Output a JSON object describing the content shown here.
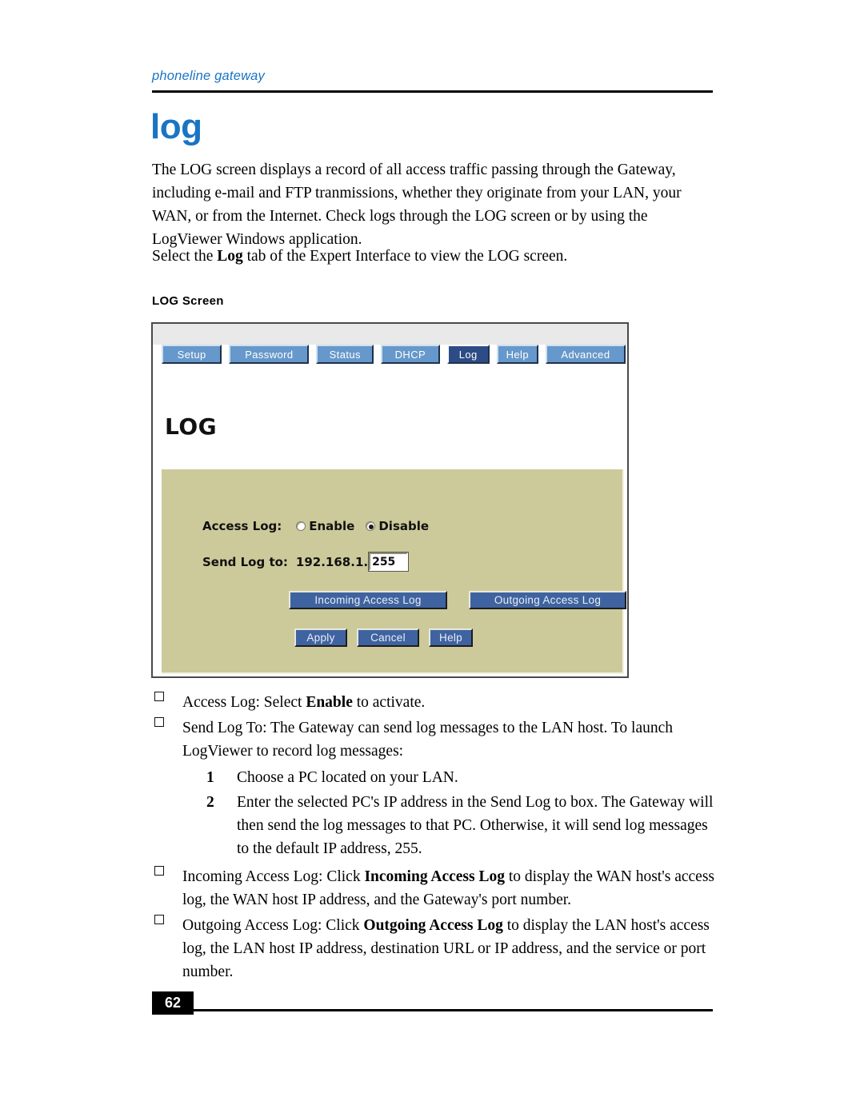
{
  "header": {
    "running_head": "phoneline gateway"
  },
  "chapter": {
    "title": "log"
  },
  "body": {
    "paragraph_1_part1": "The LOG screen displays a record of all access traffic passing through the Gateway, including e-mail and FTP tranmissions, whether they originate from your LAN, your WAN, or from the Internet. Check logs through the LOG screen or by using the LogViewer Windows application.",
    "paragraph_2_pre": "Select the ",
    "paragraph_2_bold": "Log",
    "paragraph_2_post": " tab of the Expert Interface to view the LOG screen."
  },
  "figure": {
    "caption": "LOG Screen",
    "tabs": [
      {
        "label": "Setup",
        "active": false
      },
      {
        "label": "Password",
        "active": false
      },
      {
        "label": "Status",
        "active": false
      },
      {
        "label": "DHCP",
        "active": false
      },
      {
        "label": "Log",
        "active": true
      },
      {
        "label": "Help",
        "active": false
      },
      {
        "label": "Advanced",
        "active": false
      }
    ],
    "screen_heading": "LOG",
    "fields": {
      "access_log_label": "Access Log:",
      "access_log_option_enable": "Enable",
      "access_log_option_disable": "Disable",
      "access_log_selected": "Disable",
      "send_log_label": "Send Log to:",
      "send_log_prefix": "192.168.1.",
      "send_log_value": "255"
    },
    "buttons": {
      "incoming_access_log": "Incoming Access Log",
      "outgoing_access_log": "Outgoing Access Log",
      "apply": "Apply",
      "cancel": "Cancel",
      "help": "Help"
    },
    "colors": {
      "tab_inactive": "#6698cb",
      "tab_active": "#2d4c86",
      "panel_background": "#ccca9a",
      "button_face": "#3f63a0",
      "topbar": "#e9e9e9"
    }
  },
  "bullets": [
    {
      "pre": "Access Log:  Select ",
      "bold": "Enable",
      "post": " to activate."
    },
    {
      "pre": "Send Log To:  The Gateway can send log messages to the LAN host. To launch LogViewer to record log messages:",
      "bold": "",
      "post": ""
    },
    {
      "pre": "Incoming Access Log:  Click ",
      "bold": "Incoming Access Log",
      "post": " to display the WAN host's access log, the WAN host IP address, and the Gateway's port number."
    },
    {
      "pre": "Outgoing Access Log:  Click ",
      "bold": "Outgoing Access Log",
      "post": " to display the LAN host's access log, the LAN host IP address, destination URL or IP address, and the service or port number."
    }
  ],
  "numbered_steps": [
    {
      "num": "1",
      "text": "Choose a PC located on your LAN."
    },
    {
      "num": "2",
      "text": "Enter the selected PC's IP address in the Send Log to box. The Gateway will then send the log messages to that PC. Otherwise, it will send log messages to the default IP address, 255."
    }
  ],
  "footer": {
    "page_number": "62"
  },
  "theme": {
    "accent_blue": "#1a74c4"
  }
}
